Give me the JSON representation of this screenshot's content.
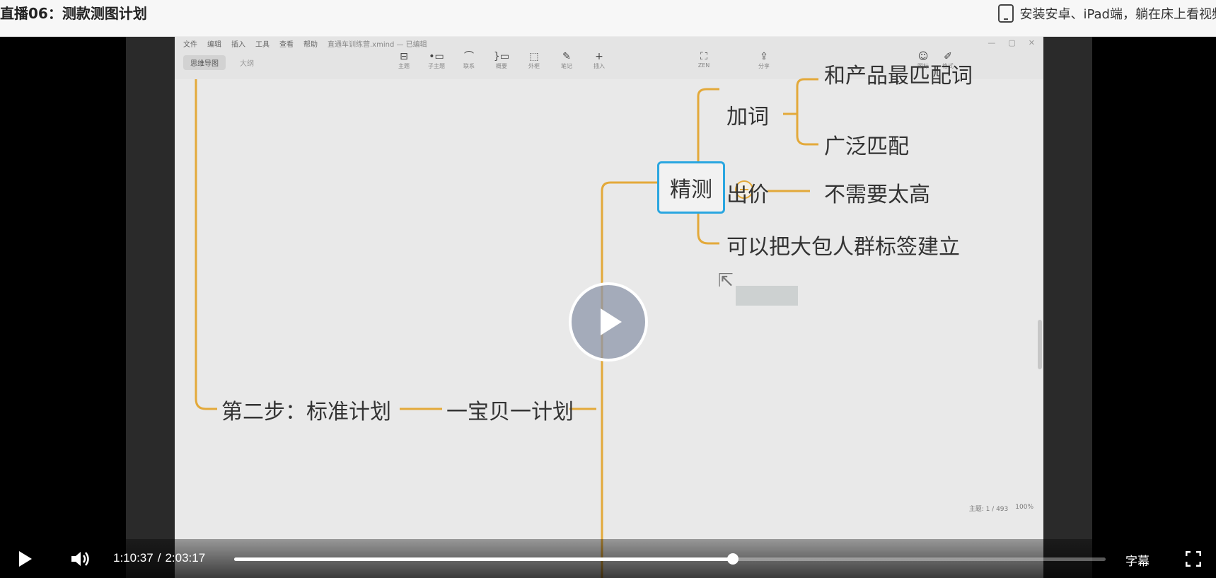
{
  "header": {
    "title": "直播06：测款测图计划",
    "promo_text": "安装安卓、iPad端，躺在床上看视频"
  },
  "app": {
    "menu": [
      "文件",
      "编辑",
      "插入",
      "工具",
      "查看",
      "帮助"
    ],
    "file_name": "直通车训练营.xmind — 已编辑",
    "view_tabs": [
      "思维导图",
      "大纲"
    ],
    "tools": [
      {
        "icon": "topic-icon",
        "glyph": "⊟",
        "label": "主题"
      },
      {
        "icon": "subtopic-icon",
        "glyph": "•▭",
        "label": "子主题"
      },
      {
        "icon": "relation-icon",
        "glyph": "⌒",
        "label": "联系"
      },
      {
        "icon": "summary-icon",
        "glyph": "}▭",
        "label": "概要"
      },
      {
        "icon": "boundary-icon",
        "glyph": "⬚",
        "label": "外框"
      },
      {
        "icon": "note-icon",
        "glyph": "✎",
        "label": "笔记"
      },
      {
        "icon": "insert-icon",
        "glyph": "+",
        "label": "插入"
      }
    ],
    "zen": {
      "glyph": "⛶",
      "label": "ZEN"
    },
    "share": {
      "glyph": "⇪",
      "label": "分享"
    },
    "icons_btn": {
      "glyph": "☺",
      "label": "图标"
    },
    "format_btn": {
      "glyph": "✐",
      "label": "格式"
    },
    "status": {
      "topics": "主题: 1 / 493",
      "zoom": "100%"
    }
  },
  "mindmap": {
    "step2": "第二步：标准计划",
    "one_item": "一宝贝一计划",
    "focus": "精测",
    "add_word": "加词",
    "match_best": "和产品最匹配词",
    "broad": "广泛匹配",
    "bid": "出价",
    "not_high": "不需要太高",
    "crowd": "可以把大包人群标签建立"
  },
  "player": {
    "current_time": "1:10:37",
    "separator": "/",
    "duration": "2:03:17",
    "progress_fraction": 0.5726,
    "subtitles_label": "字幕"
  }
}
